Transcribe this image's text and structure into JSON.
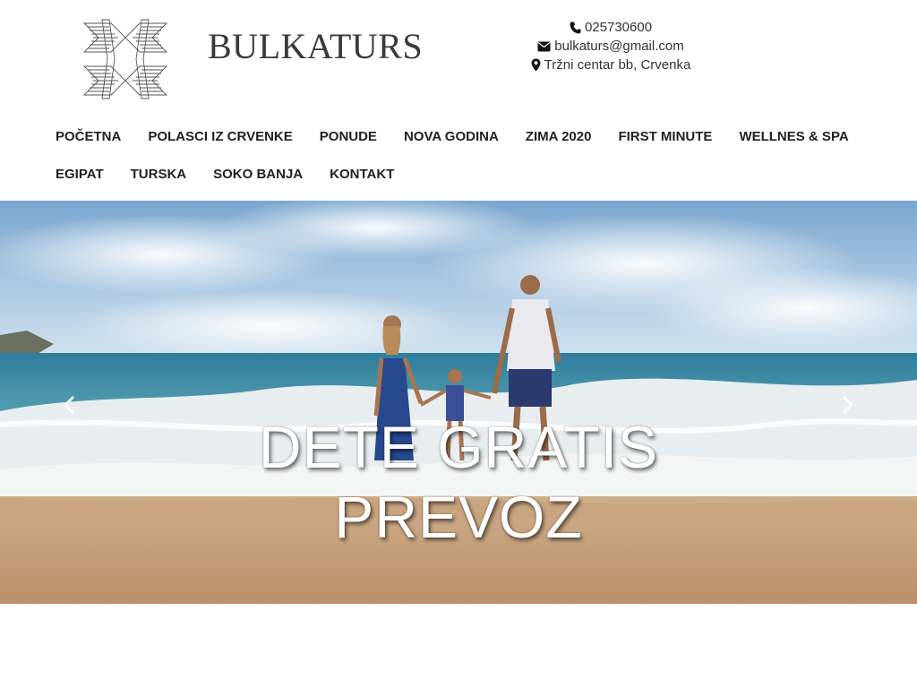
{
  "brand": {
    "name": "BULKATURS",
    "logo_icon": "star-ornament-logo"
  },
  "contact": {
    "phone": "025730600",
    "email": "bulkaturs@gmail.com",
    "address": "Tržni centar bb, Crvenka",
    "icons": [
      "phone-icon",
      "envelope-icon",
      "map-marker-icon"
    ]
  },
  "nav": {
    "row1": [
      "POČETNA",
      "POLASCI IZ CRVENKE",
      "PONUDE",
      "NOVA GODINA",
      "ZIMA 2020",
      "FIRST MINUTE",
      "WELLNES & SPA"
    ],
    "row2": [
      "EGIPAT",
      "TURSKA",
      "SOKO BANJA",
      "KONTAKT"
    ]
  },
  "hero": {
    "caption_line1": "DETE GRATIS",
    "caption_line2": "PREVOZ",
    "prev_icon": "chevron-left-icon",
    "next_icon": "chevron-right-icon"
  },
  "colors": {
    "text": "#333333",
    "nav_text": "#222222",
    "caption": "#ffffff"
  }
}
